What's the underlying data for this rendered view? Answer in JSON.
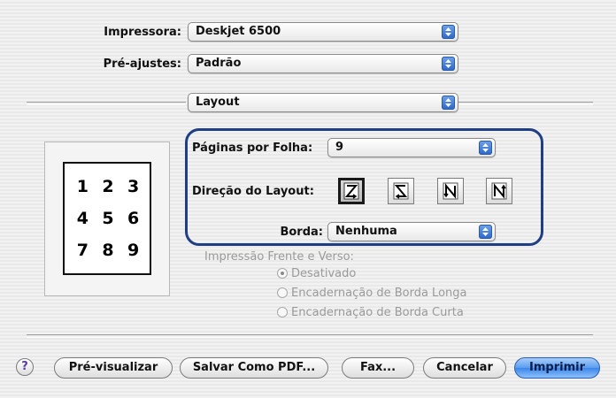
{
  "printer": {
    "label": "Impressora:",
    "value": "Deskjet 6500"
  },
  "presets": {
    "label": "Pré-ajustes:",
    "value": "Padrão"
  },
  "panel": {
    "value": "Layout"
  },
  "preview": {
    "numbers": [
      "1",
      "2",
      "3",
      "4",
      "5",
      "6",
      "7",
      "8",
      "9"
    ]
  },
  "layout": {
    "pages_per_sheet": {
      "label": "Páginas por Folha:",
      "value": "9"
    },
    "direction": {
      "label": "Direção do Layout:",
      "options": [
        {
          "icon": "z-order-icon",
          "selected": true
        },
        {
          "icon": "reverse-z-order-icon",
          "selected": false
        },
        {
          "icon": "n-reverse-order-icon",
          "selected": false
        },
        {
          "icon": "n-order-icon",
          "selected": false
        }
      ]
    },
    "border": {
      "label": "Borda:",
      "value": "Nenhuma"
    }
  },
  "duplex": {
    "label": "Impressão Frente e Verso:",
    "options": [
      {
        "label": "Desativado",
        "selected": true
      },
      {
        "label": "Encadernação de Borda Longa",
        "selected": false
      },
      {
        "label": "Encadernação de Borda Curta",
        "selected": false
      }
    ]
  },
  "buttons": {
    "help": "?",
    "preview": "Pré-visualizar",
    "save_pdf": "Salvar Como PDF...",
    "fax": "Fax...",
    "cancel": "Cancelar",
    "print": "Imprimir"
  },
  "colors": {
    "accent": "#3d86ea",
    "highlight_border": "#1f3e85",
    "disabled_text": "#9a9a9a"
  }
}
